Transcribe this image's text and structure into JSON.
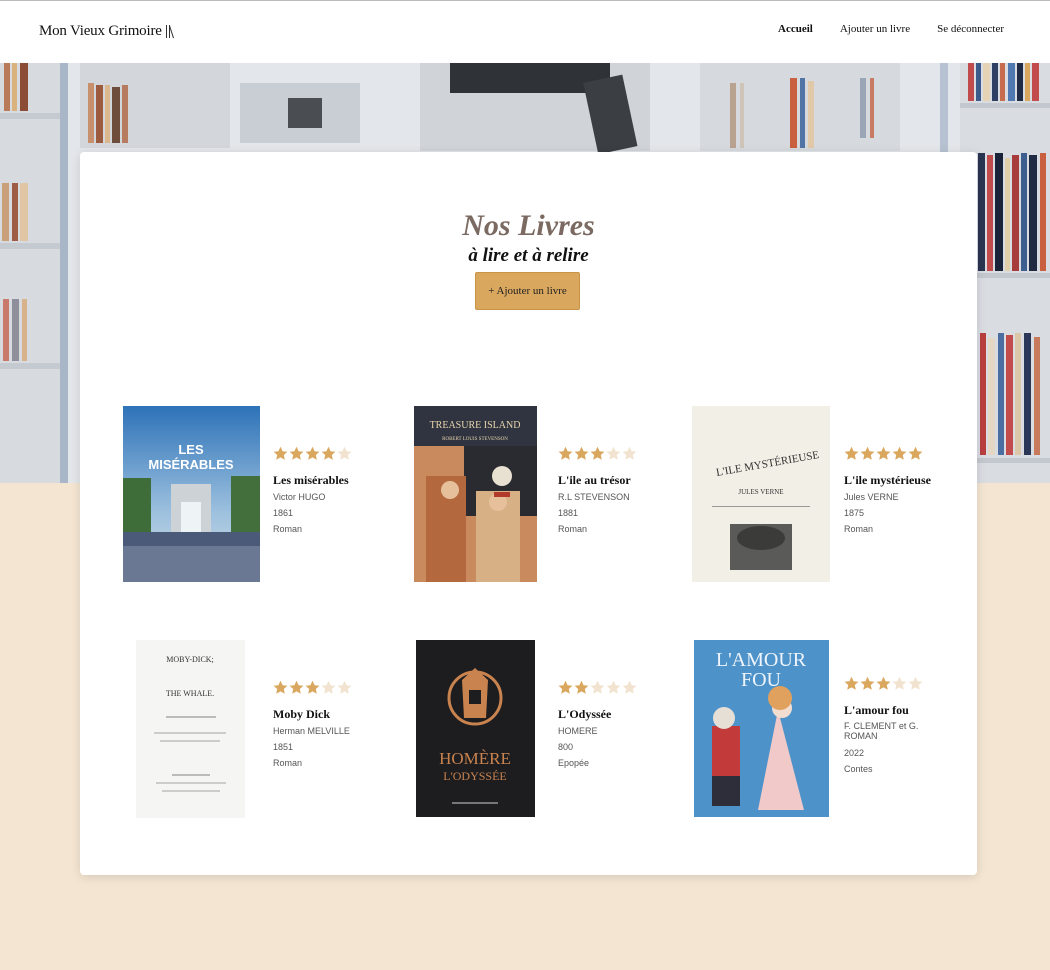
{
  "header": {
    "logo_text": "Mon Vieux Grimoire",
    "nav": [
      {
        "label": "Accueil",
        "active": true
      },
      {
        "label": "Ajouter un livre",
        "active": false
      },
      {
        "label": "Se déconnecter",
        "active": false
      }
    ]
  },
  "main": {
    "title": "Nos Livres",
    "subtitle": "à lire et à relire",
    "add_button_label": "+ Ajouter un livre"
  },
  "colors": {
    "accent": "#D9A75D",
    "star_filled": "#D9A75D",
    "star_empty": "#F1E3CF",
    "page_background": "#F4E5D2"
  },
  "books": [
    {
      "title": "Les misérables",
      "author": "Victor HUGO",
      "year": "1861",
      "genre": "Roman",
      "rating": 4,
      "cover_lines": [
        "LES",
        "MISÉRABLES"
      ]
    },
    {
      "title": "L'ile au trésor",
      "author": "R.L STEVENSON",
      "year": "1881",
      "genre": "Roman",
      "rating": 3,
      "cover_lines": [
        "TREASURE ISLAND",
        "ROBERT LOUIS STEVENSON"
      ]
    },
    {
      "title": "L'ile mystérieuse",
      "author": "Jules VERNE",
      "year": "1875",
      "genre": "Roman",
      "rating": 5,
      "cover_lines": [
        "L'ILE MYSTÉRIEUSE",
        "JULES VERNE"
      ]
    },
    {
      "title": "Moby Dick",
      "author": "Herman MELVILLE",
      "year": "1851",
      "genre": "Roman",
      "rating": 3,
      "cover_lines": [
        "MOBY-DICK;",
        "THE WHALE."
      ]
    },
    {
      "title": "L'Odyssée",
      "author": "HOMERE",
      "year": "800",
      "genre": "Epopée",
      "rating": 2,
      "cover_lines": [
        "HOMÈRE",
        "L'ODYSSÉE"
      ]
    },
    {
      "title": "L'amour fou",
      "author": "F. CLEMENT et G. ROMAN",
      "year": "2022",
      "genre": "Contes",
      "rating": 3,
      "cover_lines": [
        "L'AMOUR",
        "FOU"
      ]
    }
  ]
}
